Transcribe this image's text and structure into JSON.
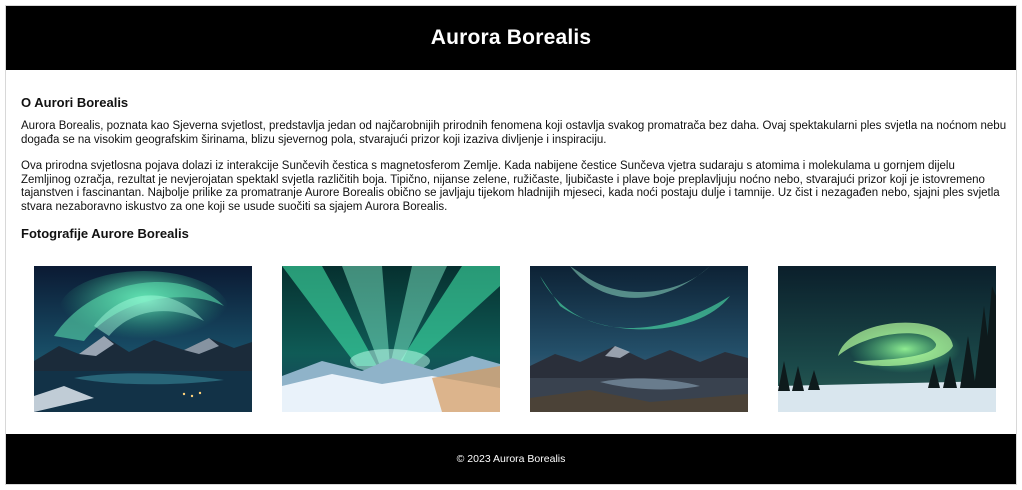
{
  "header": {
    "title": "Aurora Borealis"
  },
  "about": {
    "heading": "O Aurori Borealis",
    "paragraphs": [
      "Aurora Borealis, poznata kao Sjeverna svjetlost, predstavlja jedan od najčarobnijih prirodnih fenomena koji ostavlja svakog promatrača bez daha. Ovaj spektakularni ples svjetla na noćnom nebu događa se na visokim geografskim širinama, blizu sjevernog pola, stvarajući prizor koji izaziva divljenje i inspiraciju.",
      "Ova prirodna svjetlosna pojava dolazi iz interakcije Sunčevih čestica s magnetosferom Zemlje. Kada nabijene čestice Sunčeva vjetra sudaraju s atomima i molekulama u gornjem dijelu Zemljinog ozračja, rezultat je nevjerojatan spektakl svjetla različitih boja. Tipično, nijanse zelene, ružičaste, ljubičaste i plave boje preplavljuju noćno nebo, stvarajući prizor koji je istovremeno tajanstven i fascinantan. Najbolje prilike za promatranje Aurore Borealis obično se javljaju tijekom hladnijih mjeseci, kada noći postaju dulje i tamnije. Uz čist i nezagađen nebo, sjajni ples svjetla stvara nezaboravno iskustvo za one koji se usude suočiti sa sjajem Aurora Borealis."
    ]
  },
  "gallery": {
    "heading": "Fotografije Aurore Borealis"
  },
  "footer": {
    "copyright": "© 2023 Aurora Borealis"
  },
  "colors": {
    "header_background": "#000000",
    "footer_background": "#000000",
    "header_text": "#ffffff",
    "body_text": "#111111",
    "aurora_green": "#3fe3a0",
    "night_sky": "#0c1f3a"
  }
}
